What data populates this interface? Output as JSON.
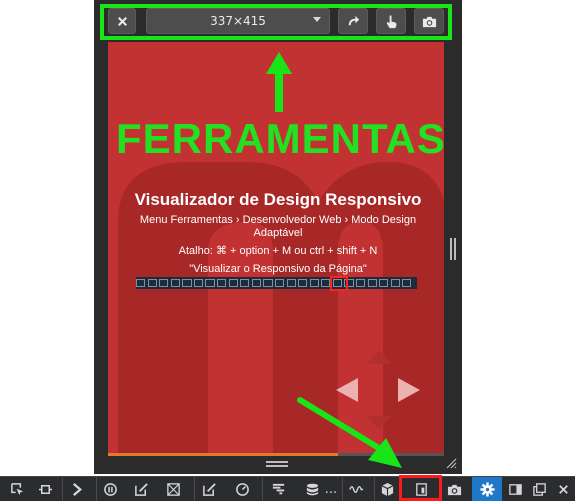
{
  "toolbar": {
    "size_label": "337×415",
    "icons": [
      "close-icon",
      "rotate-icon",
      "touch-icon",
      "camera-icon"
    ]
  },
  "overlay": {
    "heading": "FERRAMENTAS",
    "accent_color": "#18e518",
    "highlight_color": "#ff1a1a"
  },
  "page": {
    "background_color": "#c23232",
    "title": "Visualizador de Design Responsivo",
    "line1": "Menu Ferramentas › Desenvolvedor Web › Modo Design",
    "line2": "Adaptável",
    "shortcut": "Atalho: ⌘ + option + M ou ctrl + shift + N",
    "quote": "\"Visualizar o Responsivo da Página\""
  },
  "devtools": {
    "overflow_label": "...",
    "active_color": "#1f77c7",
    "icons": [
      "inspector-icon",
      "responsive-frame-icon",
      "console-icon",
      "debugger-icon",
      "style-editor-icon",
      "grid-icon",
      "scratchpad-icon",
      "performance-icon",
      "network-icon",
      "storage-icon",
      "more-icon",
      "audio-icon",
      "3d-view-icon",
      "responsive-design-icon",
      "screenshot-icon",
      "settings-icon",
      "dock-side-icon",
      "undock-icon",
      "close-icon"
    ]
  }
}
